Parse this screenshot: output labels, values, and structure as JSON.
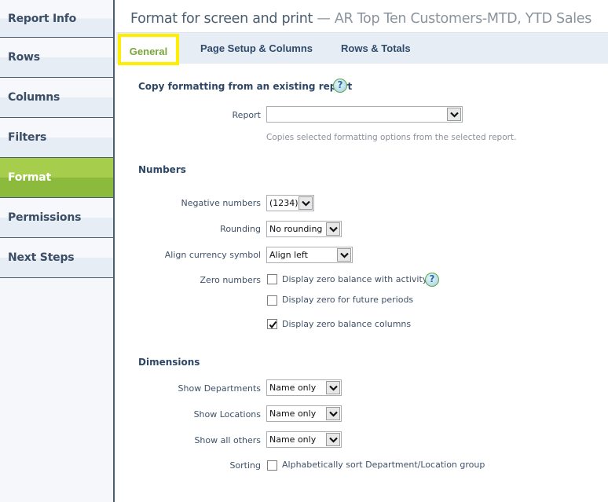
{
  "sidebar": {
    "items": [
      {
        "label": "Report Info",
        "active": false
      },
      {
        "label": "Rows",
        "active": false
      },
      {
        "label": "Columns",
        "active": false
      },
      {
        "label": "Filters",
        "active": false
      },
      {
        "label": "Format",
        "active": true
      },
      {
        "label": "Permissions",
        "active": false
      },
      {
        "label": "Next Steps",
        "active": false
      }
    ]
  },
  "header": {
    "title": "Format for screen and print",
    "separator": " — ",
    "report_name": "AR Top Ten Customers-MTD, YTD Sales"
  },
  "tabs": [
    {
      "label": "General",
      "active": true
    },
    {
      "label": "Page Setup & Columns",
      "active": false
    },
    {
      "label": "Rows & Totals",
      "active": false
    }
  ],
  "copy_section": {
    "title": "Copy formatting from an existing report",
    "help_icon": "question-circle-icon",
    "report_label": "Report",
    "report_value": "",
    "hint": "Copies selected formatting options from the selected report."
  },
  "numbers": {
    "title": "Numbers",
    "negative_label": "Negative numbers",
    "negative_value": "(1234)",
    "rounding_label": "Rounding",
    "rounding_value": "No rounding",
    "align_label": "Align currency symbol",
    "align_value": "Align left",
    "zero_label": "Zero numbers",
    "zero_options": [
      {
        "label": "Display zero balance with activity",
        "checked": false,
        "help": true
      },
      {
        "label": "Display zero for future periods",
        "checked": false,
        "help": false
      },
      {
        "label": "Display zero balance columns",
        "checked": true,
        "help": false
      }
    ]
  },
  "dimensions": {
    "title": "Dimensions",
    "departments_label": "Show Departments",
    "departments_value": "Name only",
    "locations_label": "Show Locations",
    "locations_value": "Name only",
    "others_label": "Show all others",
    "others_value": "Name only",
    "sorting_label": "Sorting",
    "sorting_option": {
      "label": "Alphabetically sort Department/Location group",
      "checked": false
    }
  },
  "colors": {
    "active_nav": "#8bba3c",
    "tab_highlight": "#ffee00",
    "active_tab_text": "#7aa53a",
    "nav_text": "#3b4e66"
  }
}
